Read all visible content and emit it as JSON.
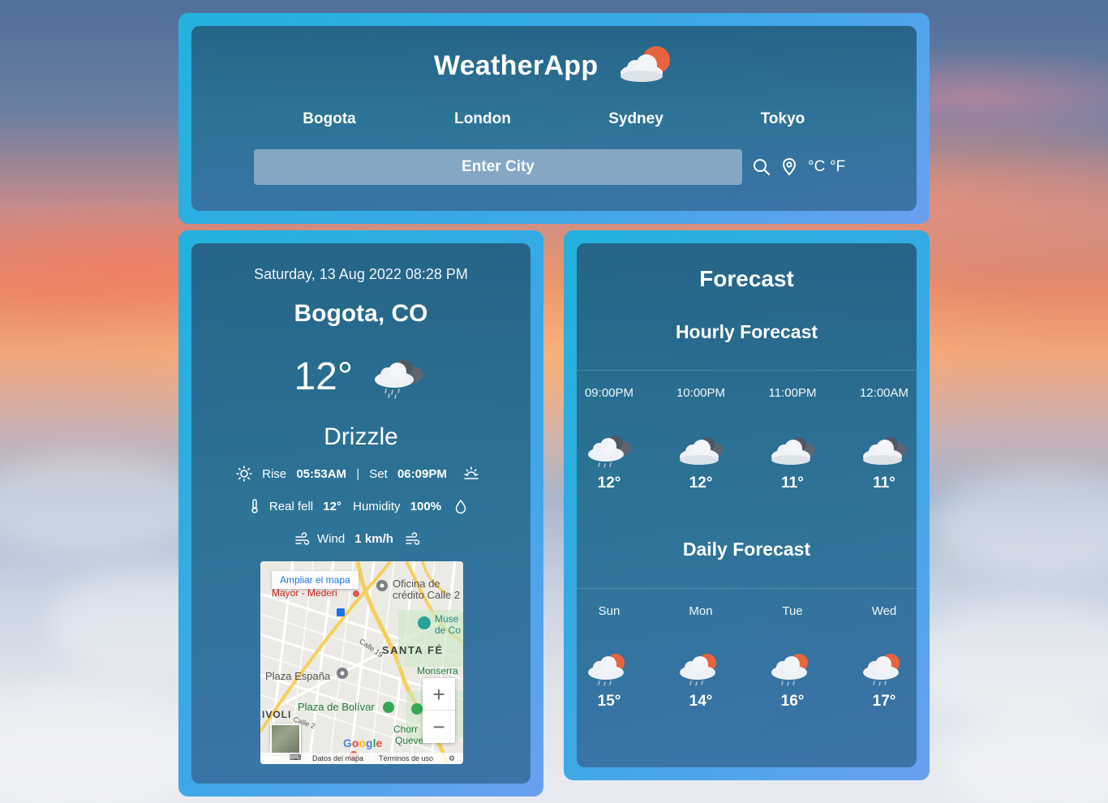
{
  "app": {
    "title": "WeatherApp"
  },
  "cities": [
    "Bogota",
    "London",
    "Sydney",
    "Tokyo"
  ],
  "search": {
    "placeholder": "Enter City"
  },
  "units": {
    "celsius": "°C",
    "fahrenheit": "°F"
  },
  "current": {
    "datetime": "Saturday, 13 Aug 2022 08:28 PM",
    "location": "Bogota, CO",
    "temp": "12°",
    "condition": "Drizzle",
    "rise_label": "Rise",
    "rise": "05:53AM",
    "separator": "|",
    "set_label": "Set",
    "set": "06:09PM",
    "realfeel_label": "Real fell",
    "realfeel": "12°",
    "humidity_label": "Humidity",
    "humidity": "100%",
    "wind_label": "Wind",
    "wind": "1 km/h"
  },
  "map": {
    "open_label": "Ampliar el mapa",
    "labels": [
      "Oficina de",
      "crédito Calle 2",
      "Mayor - Mederi",
      "Muse",
      "de Co",
      "SANTA FÉ",
      "Calle 19",
      "Monserra",
      "Plaza España",
      "Plaza de Bolívar",
      "IVOLI",
      "Calle 2",
      "Chorr",
      "Queve"
    ],
    "google": "Google",
    "footer_data": "Datos del mapa",
    "footer_terms": "Términos de uso"
  },
  "forecast": {
    "title": "Forecast",
    "hourly_title": "Hourly Forecast",
    "hourly": [
      {
        "time": "09:00PM",
        "temp": "12°",
        "icon": "drizzle-cloud-icon"
      },
      {
        "time": "10:00PM",
        "temp": "12°",
        "icon": "cloud-icon"
      },
      {
        "time": "11:00PM",
        "temp": "11°",
        "icon": "cloud-icon"
      },
      {
        "time": "12:00AM",
        "temp": "11°",
        "icon": "cloud-icon"
      }
    ],
    "daily_title": "Daily Forecast",
    "daily": [
      {
        "day": "Sun",
        "temp": "15°",
        "icon": "sun-rain-cloud-icon"
      },
      {
        "day": "Mon",
        "temp": "14°",
        "icon": "sun-rain-cloud-icon"
      },
      {
        "day": "Tue",
        "temp": "16°",
        "icon": "sun-rain-cloud-icon"
      },
      {
        "day": "Wed",
        "temp": "17°",
        "icon": "sun-rain-cloud-icon"
      }
    ]
  },
  "colors": {
    "panel_border": "#22b2dc",
    "panel_inner": "#2c6c8c",
    "sun": "#e8643c",
    "map_link": "#1a73e8"
  }
}
